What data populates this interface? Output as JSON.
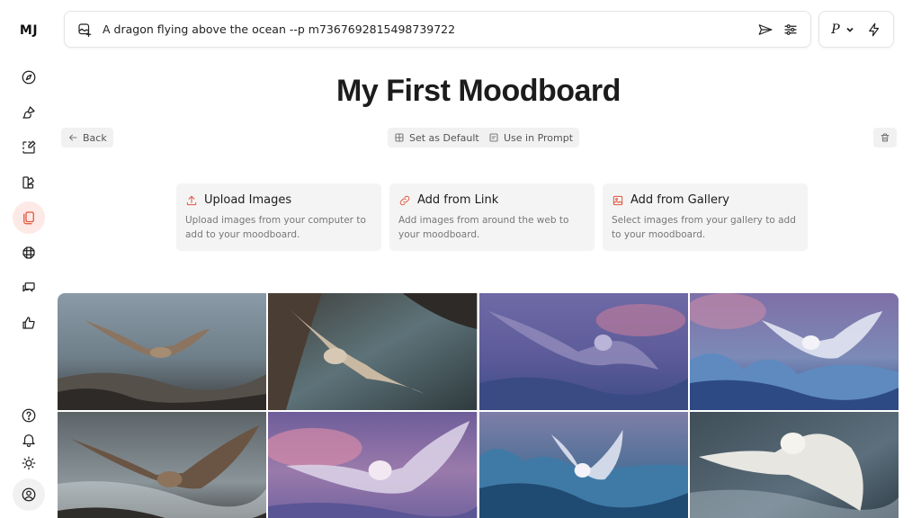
{
  "app": {
    "logo": "MJ"
  },
  "sidebar": {
    "items": [
      {
        "name": "explore",
        "icon": "compass-icon"
      },
      {
        "name": "create",
        "icon": "brush-icon"
      },
      {
        "name": "edit",
        "icon": "edit-frame-icon"
      },
      {
        "name": "personalize",
        "icon": "palette-icon"
      },
      {
        "name": "moodboards",
        "icon": "moodboard-icon",
        "active": true
      },
      {
        "name": "rooms",
        "icon": "grid-icon"
      },
      {
        "name": "chat",
        "icon": "chat-icon"
      },
      {
        "name": "rank",
        "icon": "thumbs-up-icon"
      }
    ],
    "bottom": [
      {
        "name": "help",
        "icon": "help-icon"
      },
      {
        "name": "notifications",
        "icon": "bell-icon"
      },
      {
        "name": "theme",
        "icon": "sun-icon"
      },
      {
        "name": "account",
        "icon": "user-icon"
      }
    ]
  },
  "prompt": {
    "value": "A dragon flying above the ocean --p m7367692815498739722"
  },
  "settings": {
    "personalize_label": "P"
  },
  "page": {
    "title": "My First Moodboard",
    "back_label": "Back",
    "set_default_label": "Set as Default",
    "use_in_prompt_label": "Use in Prompt"
  },
  "add_options": [
    {
      "title": "Upload Images",
      "description": "Upload images from your computer to add to your moodboard.",
      "icon": "upload-icon"
    },
    {
      "title": "Add from Link",
      "description": "Add images from around the web to your moodboard.",
      "icon": "link-icon"
    },
    {
      "title": "Add from Gallery",
      "description": "Select images from your gallery to add to your moodboard.",
      "icon": "image-icon"
    }
  ],
  "colors": {
    "accent": "#e2543c",
    "active_bg": "#fde9e6",
    "card_bg": "#f4f4f4"
  }
}
